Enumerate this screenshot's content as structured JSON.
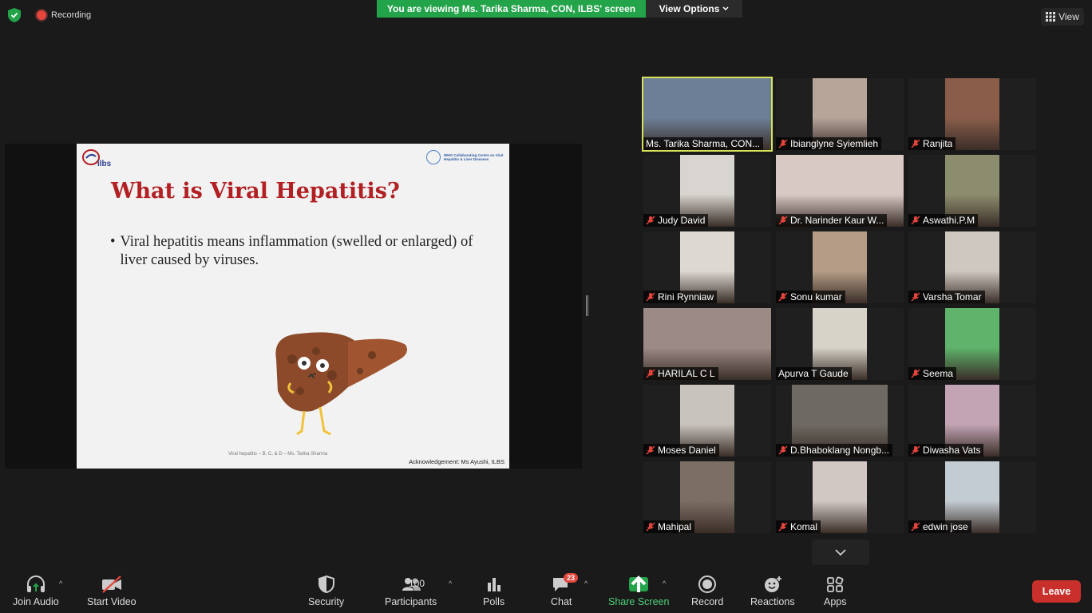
{
  "top": {
    "recording_label": "Recording",
    "viewing_banner": "You are viewing Ms. Tarika Sharma, CON, ILBS' screen",
    "view_options_label": "View Options",
    "view_label": "View"
  },
  "slide": {
    "logo_text": "ilbs",
    "who_text": "WHO Collaborating Centre on Viral Hepatitis & Liver Diseases",
    "title": "What is Viral Hepatitis?",
    "bullet": "Viral hepatitis means inflammation (swelled or enlarged) of liver caused by viruses.",
    "footer": "Viral hepatitis – B, C, & D – Ms. Tarika Sharma",
    "acknowledgement": "Acknowledgement: Ms Ayushi, ILBS"
  },
  "gallery": {
    "participants": [
      {
        "name": "Ms. Tarika Sharma, CON...",
        "muted": false,
        "active": true,
        "bg": "#6d7f96"
      },
      {
        "name": "Ibianglyne Syiemlieh",
        "muted": true,
        "active": false,
        "bg": "#b7a59a"
      },
      {
        "name": "Ranjita",
        "muted": true,
        "active": false,
        "bg": "#8a5d4b"
      },
      {
        "name": "Judy David",
        "muted": true,
        "active": false,
        "bg": "#d8d4cf"
      },
      {
        "name": "Dr. Narinder Kaur W...",
        "muted": true,
        "active": false,
        "bg": "#d9c9c4"
      },
      {
        "name": "Aswathi.P.M",
        "muted": true,
        "active": false,
        "bg": "#8c8d6e"
      },
      {
        "name": "Rini Rynniaw",
        "muted": true,
        "active": false,
        "bg": "#ddd8d2"
      },
      {
        "name": "Sonu kumar",
        "muted": true,
        "active": false,
        "bg": "#b49c86"
      },
      {
        "name": "Varsha Tomar",
        "muted": true,
        "active": false,
        "bg": "#cfc8c0"
      },
      {
        "name": "HARILAL C L",
        "muted": true,
        "active": false,
        "bg": "#9c8a86"
      },
      {
        "name": "Apurva T Gaude",
        "muted": false,
        "active": false,
        "bg": "#d7d3c8"
      },
      {
        "name": "Seema",
        "muted": true,
        "active": false,
        "bg": "#5fb36a"
      },
      {
        "name": "Moses Daniel",
        "muted": true,
        "active": false,
        "bg": "#c9c3bd"
      },
      {
        "name": "D.Bhaboklang Nongb...",
        "muted": true,
        "active": false,
        "bg": "#6e6a63"
      },
      {
        "name": "Diwasha Vats",
        "muted": true,
        "active": false,
        "bg": "#c2a4b4"
      },
      {
        "name": "Mahipal",
        "muted": true,
        "active": false,
        "bg": "#7b6f64"
      },
      {
        "name": "Komal",
        "muted": true,
        "active": false,
        "bg": "#d1c8c4"
      },
      {
        "name": "edwin jose",
        "muted": true,
        "active": false,
        "bg": "#c4ccd3"
      }
    ]
  },
  "toolbar": {
    "join_audio": "Join Audio",
    "start_video": "Start Video",
    "security": "Security",
    "participants": "Participants",
    "participants_count": "100",
    "polls": "Polls",
    "chat": "Chat",
    "chat_badge": "23",
    "share_screen": "Share Screen",
    "record": "Record",
    "reactions": "Reactions",
    "apps": "Apps",
    "leave": "Leave"
  }
}
